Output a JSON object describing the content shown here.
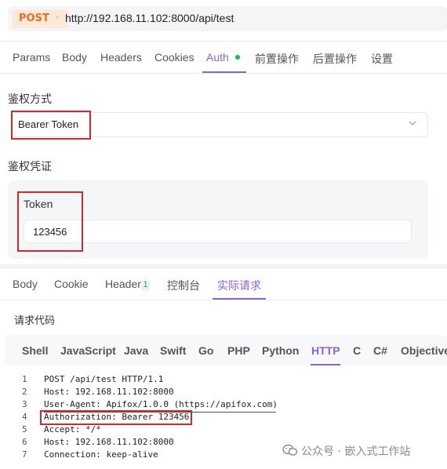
{
  "url_bar": {
    "method": "POST",
    "url": "http://192.168.11.102:8000/api/test"
  },
  "request_tabs": [
    "Params",
    "Body",
    "Headers",
    "Cookies",
    "Auth",
    "前置操作",
    "后置操作",
    "设置"
  ],
  "active_request_tab": "Auth",
  "auth": {
    "method_label": "鉴权方式",
    "method_value": "Bearer Token",
    "credential_label": "鉴权凭证",
    "token_label": "Token",
    "token_value": "123456"
  },
  "response_tabs": [
    "Body",
    "Cookie",
    "Header",
    "控制台",
    "实际请求"
  ],
  "header_count": "1",
  "active_response_tab": "实际请求",
  "request_code": {
    "title": "请求代码",
    "languages": [
      "Shell",
      "JavaScript",
      "Java",
      "Swift",
      "Go",
      "PHP",
      "Python",
      "HTTP",
      "C",
      "C#",
      "Objective"
    ],
    "active_language": "HTTP",
    "lines": [
      {
        "n": "1",
        "text": "POST /api/test HTTP/1.1"
      },
      {
        "n": "2",
        "text": "Host: 192.168.11.102:8000"
      },
      {
        "n": "3",
        "text": "User-Agent: Apifox/1.0.0 (https://apifox.com)"
      },
      {
        "n": "4",
        "text": "Authorization: Bearer 123456"
      },
      {
        "n": "5",
        "text": "Accept: */*"
      },
      {
        "n": "6",
        "text": "Host: 192.168.11.102:8000"
      },
      {
        "n": "7",
        "text": "Connection: keep-alive"
      }
    ]
  },
  "watermark": "公众号 · 嵌入式工作站",
  "colors": {
    "accent": "#8a63d2",
    "method": "#f26b1d",
    "highlight_box": "#d9262c",
    "status_dot": "#20b26b"
  }
}
